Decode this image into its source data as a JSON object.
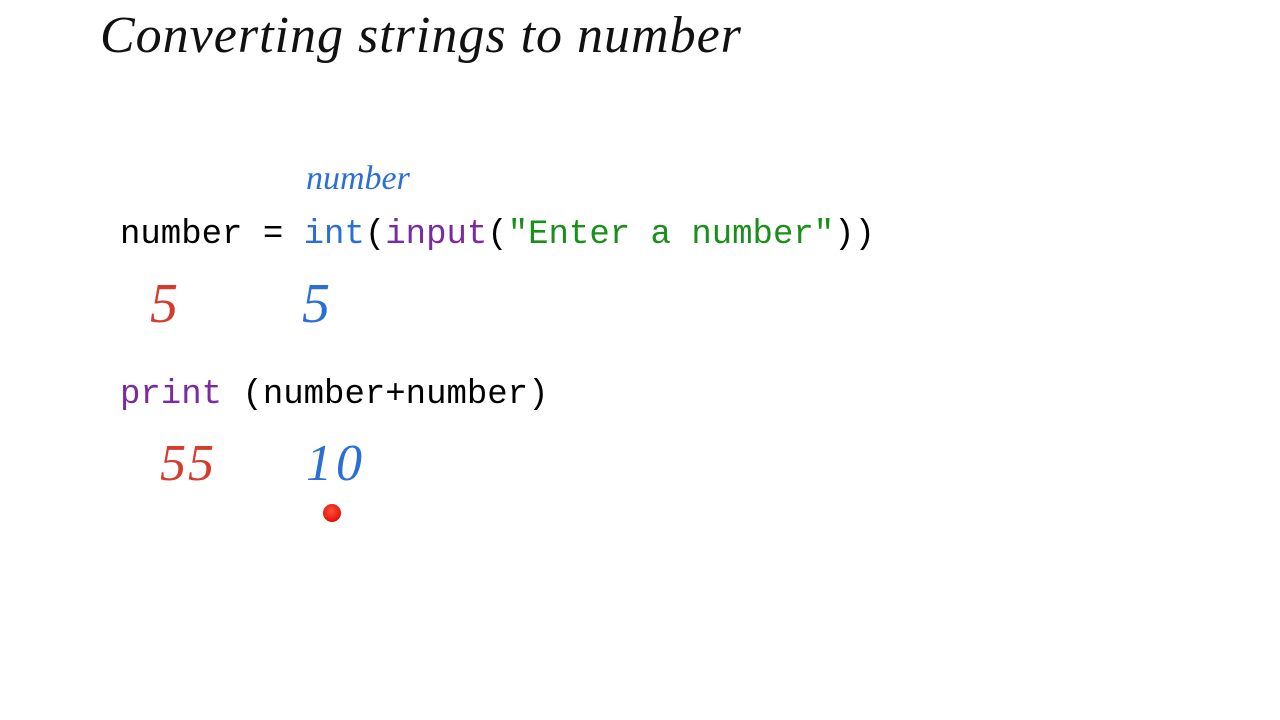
{
  "title": "Converting strings to number",
  "annotations": {
    "label_number": "number",
    "red_5": "5",
    "blue_5": "5",
    "red_55": "55",
    "blue_10": "10"
  },
  "code": {
    "line1": {
      "var": "number",
      "assign": " = ",
      "int": "int",
      "open1": "(",
      "input": "input",
      "open2": "(",
      "str": "\"Enter a number\"",
      "close": "))"
    },
    "line2": {
      "print": "print",
      "rest": " (number+number)"
    }
  }
}
